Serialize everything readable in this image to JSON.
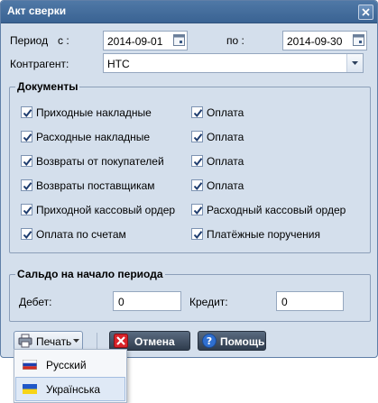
{
  "window": {
    "title": "Акт сверки"
  },
  "period": {
    "label": "Период",
    "from_label": "с :",
    "from_value": "2014-09-01",
    "to_label": "по :",
    "to_value": "2014-09-30"
  },
  "contractor": {
    "label": "Контрагент:",
    "value": "НТС"
  },
  "documents": {
    "legend": "Документы",
    "items": [
      {
        "label": "Приходные накладные",
        "checked": true
      },
      {
        "label": "Оплата",
        "checked": true
      },
      {
        "label": "Расходные накладные",
        "checked": true
      },
      {
        "label": "Оплата",
        "checked": true
      },
      {
        "label": "Возвраты от покупателей",
        "checked": true
      },
      {
        "label": "Оплата",
        "checked": true
      },
      {
        "label": "Возвраты поставщикам",
        "checked": true
      },
      {
        "label": "Оплата",
        "checked": true
      },
      {
        "label": "Приходной кассовый ордер",
        "checked": true
      },
      {
        "label": "Расходный кассовый ордер",
        "checked": true
      },
      {
        "label": "Оплата по счетам",
        "checked": true
      },
      {
        "label": "Платёжные поручения",
        "checked": true
      }
    ]
  },
  "balance": {
    "legend": "Сальдо на начало периода",
    "debit_label": "Дебет:",
    "debit_value": "0",
    "credit_label": "Кредит:",
    "credit_value": "0"
  },
  "toolbar": {
    "print_label": "Печать",
    "cancel_label": "Отмена",
    "help_label": "Помощь"
  },
  "print_menu": {
    "items": [
      {
        "label": "Русский",
        "flag": "russian-flag"
      },
      {
        "label": "Українська",
        "flag": "ukrainian-flag",
        "selected": true
      }
    ]
  },
  "colors": {
    "window_bg": "#d4dfec",
    "title_bg": "#3f6898",
    "check_mark": "#1e3c6e"
  }
}
